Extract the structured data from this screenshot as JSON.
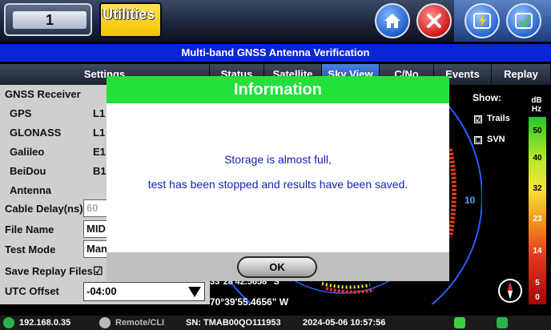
{
  "header": {
    "port_number": "1",
    "utilities_label": "Utilities",
    "title": "Multi-band GNSS Antenna Verification"
  },
  "tabs": [
    {
      "label": "Settings"
    },
    {
      "label": "Status"
    },
    {
      "label": "Satellite"
    },
    {
      "label": "Sky View"
    },
    {
      "label": "C/No"
    },
    {
      "label": "Events"
    },
    {
      "label": "Replay"
    }
  ],
  "settings": {
    "gnss_receiver_label": "GNSS Receiver",
    "gps_label": "GPS",
    "gps_value": "L1",
    "glonass_label": "GLONASS",
    "glonass_value": "L1",
    "galileo_label": "Galileo",
    "galileo_value": "E1",
    "beidou_label": "BeiDou",
    "beidou_value": "B1",
    "antenna_label": "Antenna",
    "cable_delay_label": "Cable Delay(ns)",
    "cable_delay_value": "60",
    "file_name_label": "File Name",
    "file_name_value": "MID",
    "test_mode_label": "Test Mode",
    "test_mode_value": "Man",
    "save_replay_label": "Save Replay Files",
    "save_replay_check": "☑",
    "utc_offset_label": "UTC Offset",
    "utc_offset_value": "-04:00"
  },
  "skyview": {
    "show_label": "Show:",
    "trails_check": "☑",
    "trails_label": "Trails",
    "svn_check": "☐",
    "svn_label": "SVN",
    "db_unit_line1": "dB",
    "db_unit_line2": "Hz",
    "db_ticks": [
      "50",
      "40",
      "32",
      "23",
      "14",
      "5",
      "0"
    ],
    "lat_readout": "33°28'42.5658\" S",
    "lon_readout": "70°39'55.4656\" W",
    "sat_label": "10"
  },
  "dialog": {
    "title": "Information",
    "line1": "Storage is almost full,",
    "line2": "test has been stopped and results have been saved.",
    "ok_label": "OK"
  },
  "status_bar": {
    "ip": "192.168.0.35",
    "remote": "Remote/CLI",
    "serial": "SN: TMAB00QO111953",
    "datetime": "2024-05-06  10:57:56"
  },
  "colors": {
    "title_bar": "#0a24d8",
    "dialog_header": "#22e13a",
    "message_text": "#1423b8"
  }
}
